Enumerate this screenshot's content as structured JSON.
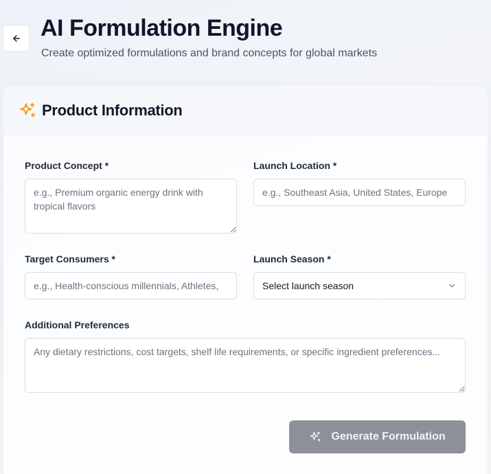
{
  "header": {
    "title": "AI Formulation Engine",
    "subtitle": "Create optimized formulations and brand concepts for global markets",
    "back_icon": "arrow-left-icon"
  },
  "card": {
    "title": "Product Information",
    "title_icon": "sparkles-icon",
    "accent_color": "#f59e0b"
  },
  "form": {
    "product_concept": {
      "label": "Product Concept *",
      "placeholder": "e.g., Premium organic energy drink with tropical flavors",
      "value": ""
    },
    "launch_location": {
      "label": "Launch Location *",
      "placeholder": "e.g., Southeast Asia, United States, Europe",
      "value": ""
    },
    "target_consumers": {
      "label": "Target Consumers *",
      "placeholder": "e.g., Health-conscious millennials, Athletes,",
      "value": ""
    },
    "launch_season": {
      "label": "Launch Season *",
      "selected": "Select launch season",
      "icon": "chevron-down-icon"
    },
    "additional_preferences": {
      "label": "Additional Preferences",
      "placeholder": "Any dietary restrictions, cost targets, shelf life requirements, or specific ingredient preferences...",
      "value": ""
    }
  },
  "actions": {
    "generate_label": "Generate Formulation",
    "generate_icon": "sparkles-icon",
    "button_color": "#8c9099"
  }
}
